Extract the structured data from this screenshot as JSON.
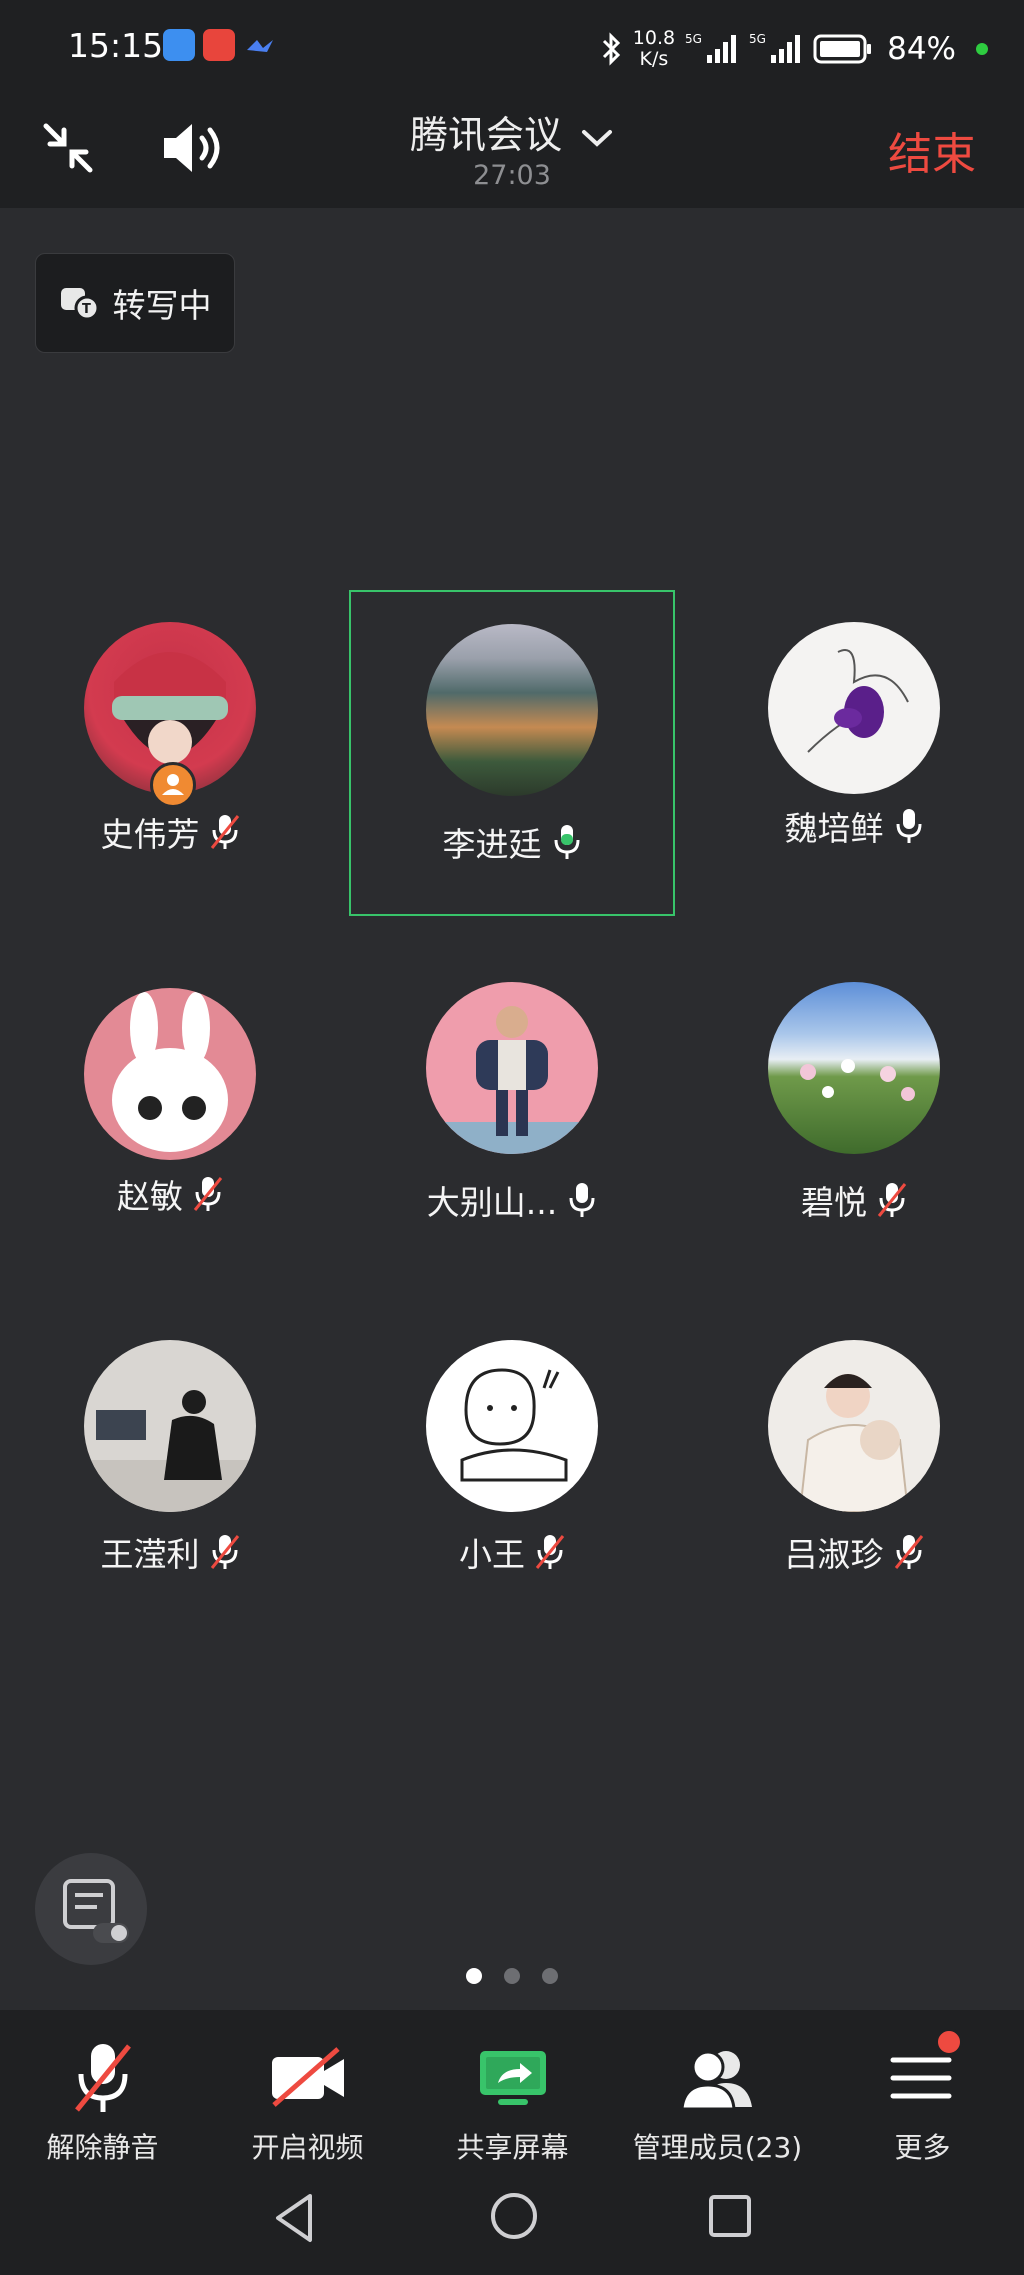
{
  "status_bar": {
    "time": "15:15",
    "speed_value": "10.8",
    "speed_unit": "K/s",
    "battery": "84%"
  },
  "header": {
    "title": "腾讯会议",
    "duration": "27:03",
    "end_label": "结束"
  },
  "transcribe": {
    "label": "转写中"
  },
  "participants": [
    {
      "name": "史伟芳",
      "mic": "muted",
      "host": true
    },
    {
      "name": "李进廷",
      "mic": "speaking",
      "active": true
    },
    {
      "name": "魏培鲜",
      "mic": "on"
    },
    {
      "name": "赵敏",
      "mic": "muted"
    },
    {
      "name": "大别山...",
      "mic": "on"
    },
    {
      "name": "碧悦",
      "mic": "muted"
    },
    {
      "name": "王滢利",
      "mic": "muted"
    },
    {
      "name": "小王",
      "mic": "muted"
    },
    {
      "name": "吕淑珍",
      "mic": "muted"
    }
  ],
  "pagination": {
    "total": 3,
    "current": 1
  },
  "toolbar": {
    "unmute": "解除静音",
    "video": "开启视频",
    "share": "共享屏幕",
    "members": "管理成员(23)",
    "more": "更多"
  },
  "colors": {
    "accent_green": "#38c46a",
    "end_red": "#ee4a40",
    "background": "#2b2c2f"
  }
}
